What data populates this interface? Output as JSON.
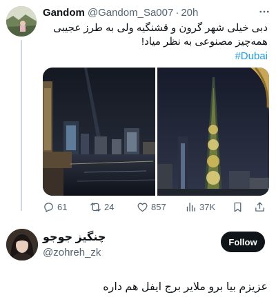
{
  "post": {
    "author_name": "Gandom",
    "author_handle": "@Gandom_Sa007",
    "separator": "·",
    "time": "20h",
    "text": "دبی خیلی شهر گرون و قشنگیه ولی به طرز عجیبی همه‌چیز مصنوعی به نظر میاد!",
    "hashtag": "#Dubai",
    "media": [
      "dubai-creek-night-photo",
      "burj-khalifa-night-photo"
    ],
    "stats": {
      "replies": "61",
      "reposts": "24",
      "likes": "857",
      "views": "37K"
    }
  },
  "reply": {
    "author_name": "چنگیز جوجو",
    "author_handle": "@zohreh_zk",
    "follow_label": "Follow",
    "text": "عزیزم بیا برو ملایر برج ایفل هم داره"
  },
  "colors": {
    "accent": "#1d9bf0",
    "text": "#0f1419",
    "muted": "#536471",
    "follow_bg": "#0f1419"
  },
  "icons": [
    "more-icon",
    "reply-icon",
    "repost-icon",
    "like-icon",
    "views-icon",
    "bookmark-icon",
    "share-icon"
  ]
}
